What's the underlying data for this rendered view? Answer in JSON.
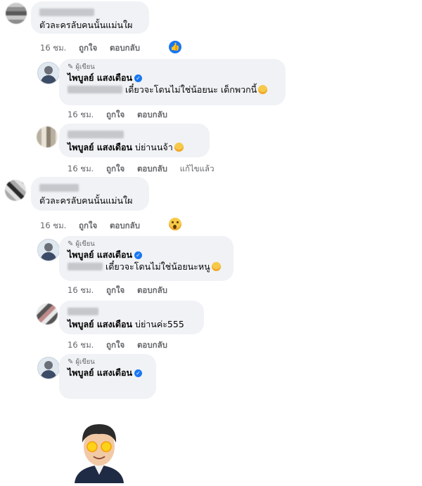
{
  "comments": [
    {
      "text": "ตัวละครลับคนนั้นแม่นใผ",
      "time": "16 ชม.",
      "like": "ถูกใจ",
      "reply": "ตอบกลับ"
    },
    {
      "badge": "ผู้เขียน",
      "author": "ไพบูลย์ แสงเดือน",
      "text": "เดี๋ยวจะโดนไม่ใช่น้อยนะ เด็กพวกนี้",
      "time": "16 ชม.",
      "like": "ถูกใจ",
      "reply": "ตอบกลับ"
    },
    {
      "author": "ไพบูลย์ แสงเดือน",
      "text": "บ่ย่านนจ้า",
      "time": "16 ชม.",
      "like": "ถูกใจ",
      "reply": "ตอบกลับ",
      "edited": "แก้ไขแล้ว"
    },
    {
      "text": "ตัวละครลับคนนั้นแม่นใผ",
      "time": "16 ชม.",
      "like": "ถูกใจ",
      "reply": "ตอบกลับ"
    },
    {
      "badge": "ผู้เขียน",
      "author": "ไพบูลย์ แสงเดือน",
      "text": "เดี๋ยวจะโดนไม่ใช่น้อยนะหนู",
      "time": "16 ชม.",
      "like": "ถูกใจ",
      "reply": "ตอบกลับ"
    },
    {
      "author": "ไพบูลย์ แสงเดือน",
      "text": "บ่ย่านค่ะ555",
      "time": "16 ชม.",
      "like": "ถูกใจ",
      "reply": "ตอบกลับ"
    },
    {
      "badge": "ผู้เขียน",
      "author": "ไพบูลย์ แสงเดือน"
    }
  ],
  "reactions": {
    "like_icon": "thumbs-up-icon",
    "wow_icon": "wow-emoji-icon",
    "like_color": "#1877f2"
  }
}
